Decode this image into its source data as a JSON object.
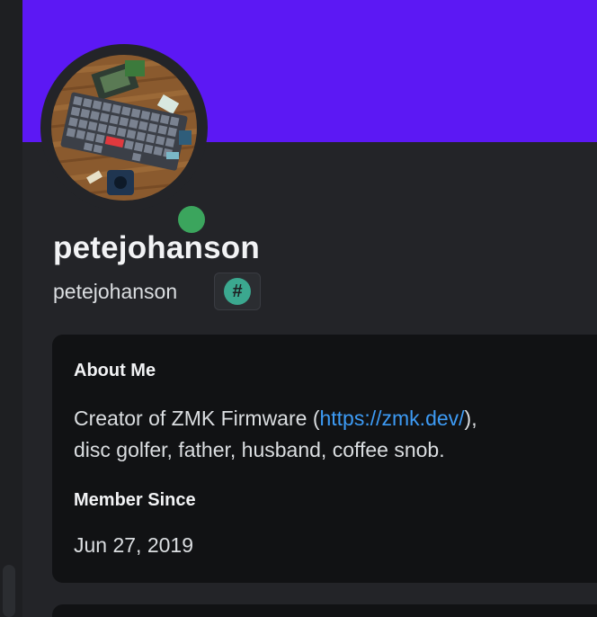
{
  "profile": {
    "display_name": "petejohanson",
    "username": "petejohanson",
    "status": "online",
    "status_color": "#3ba55d",
    "banner_color": "#5c18f4",
    "badge": {
      "icon": "hashtag-icon",
      "glyph": "#",
      "color": "#3ba88f"
    }
  },
  "about": {
    "title": "About Me",
    "bio_prefix": "Creator of ZMK Firmware (",
    "bio_link": "https://zmk.dev/",
    "bio_middle": "),",
    "bio_suffix": "disc golfer, father, husband, coffee snob."
  },
  "member_since": {
    "title": "Member Since",
    "value": "Jun 27, 2019"
  }
}
